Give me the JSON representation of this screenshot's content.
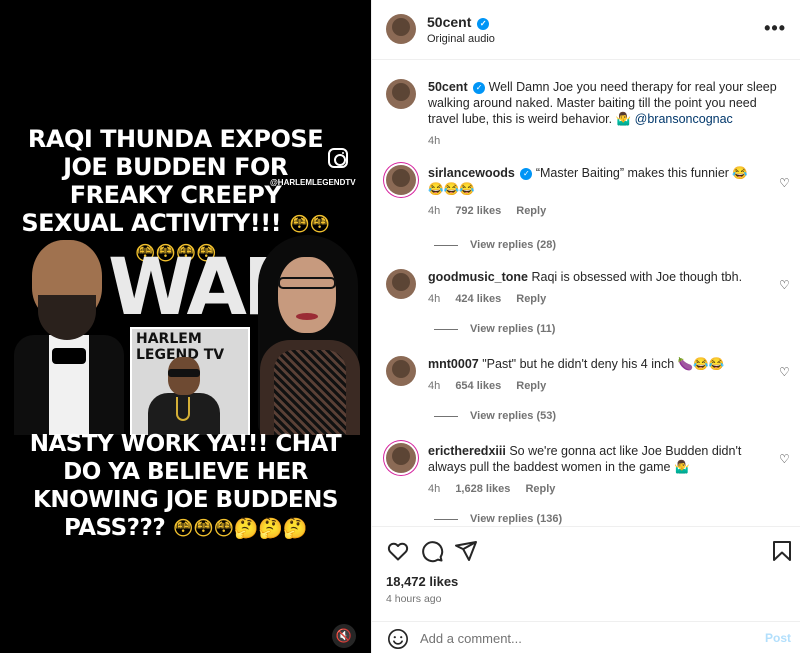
{
  "media": {
    "headline_top": "RAQI THUNDA EXPOSE JOE BUDDEN FOR FREAKY CREEPY SEXUAL ACTIVITY!!!",
    "headline_top_emojis": "😳😳😳😳😳😳",
    "watermark": "@HARLEMLEGENDTV",
    "war_text": "WAR",
    "logo_text": "HARLEM LEGEND TV",
    "headline_bottom": "NASTY WORK YA!!! CHAT DO YA BELIEVE HER KNOWING JOE BUDDENS PASS???",
    "headline_bottom_emojis": "😳😳😳🤔🤔🤔",
    "mute_icon": "🔇"
  },
  "header": {
    "username": "50cent",
    "subtitle": "Original audio",
    "more_label": "•••"
  },
  "caption": {
    "username": "50cent",
    "text": "Well Damn Joe you need therapy for real your sleep walking around naked. Master baiting till the point you need travel lube, this is weird behavior. 🤷‍♂️",
    "mention": "@bransoncognac",
    "time": "4h"
  },
  "comments": [
    {
      "username": "sirlancewoods",
      "verified": true,
      "text": "“Master Baiting” makes this funnier 😂😂😂😂",
      "time": "4h",
      "likes": "792 likes",
      "reply": "Reply",
      "view_replies": "View replies (28)"
    },
    {
      "username": "goodmusic_tone",
      "text": "Raqi is obsessed with Joe though tbh.",
      "time": "4h",
      "likes": "424 likes",
      "reply": "Reply",
      "view_replies": "View replies (11)"
    },
    {
      "username": "mnt0007",
      "text": "\"Past\" but he didn't deny his 4 inch 🍆😂😂",
      "time": "4h",
      "likes": "654 likes",
      "reply": "Reply",
      "view_replies": "View replies (53)"
    },
    {
      "username": "erictheredxiii",
      "text": "So we're gonna act like Joe Budden didn't always pull the baddest women in the game 🤷‍♂️",
      "time": "4h",
      "likes": "1,628 likes",
      "reply": "Reply",
      "view_replies": "View replies (136)"
    }
  ],
  "actions": {
    "likes": "18,472 likes",
    "time_ago": "4 hours ago"
  },
  "composer": {
    "placeholder": "Add a comment...",
    "post_label": "Post"
  },
  "colors": {
    "verified": "#0095f6",
    "muted_text": "#737373",
    "post_disabled": "#b2dffc",
    "mention": "#00376b"
  }
}
